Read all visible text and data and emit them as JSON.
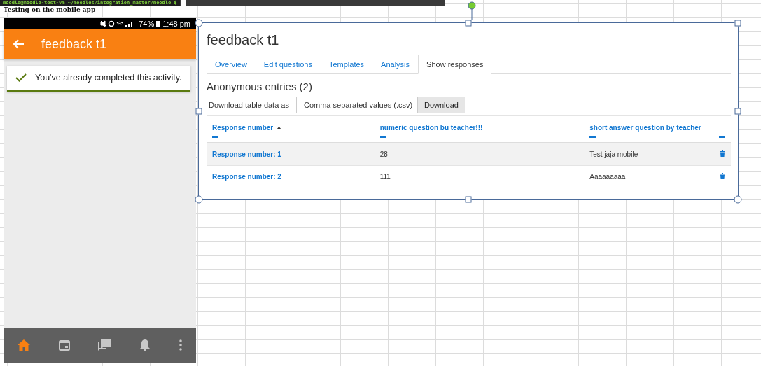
{
  "terminal": {
    "prompt": "moodle@moodle-test-vm ~/moodles/integration_master/moodle $"
  },
  "sheet_note": "Testing on the mobile app",
  "phone": {
    "status_bar": {
      "battery": "74%",
      "time": "1:48 pm"
    },
    "header": {
      "title": "feedback t1"
    },
    "notice": {
      "text": "You've already completed this activity."
    },
    "bottom_nav": [
      {
        "kind": "home",
        "selected": true
      },
      {
        "kind": "calendar",
        "selected": false
      },
      {
        "kind": "messages",
        "selected": false
      },
      {
        "kind": "notifications",
        "selected": false
      },
      {
        "kind": "more",
        "selected": false
      }
    ]
  },
  "page": {
    "title": "feedback t1",
    "tabs": [
      {
        "label": "Overview",
        "selected": false
      },
      {
        "label": "Edit questions",
        "selected": false
      },
      {
        "label": "Templates",
        "selected": false
      },
      {
        "label": "Analysis",
        "selected": false
      },
      {
        "label": "Show responses",
        "selected": true
      }
    ],
    "heading": "Anonymous entries (2)",
    "download": {
      "label": "Download table data as",
      "format": "Comma separated values (.csv)",
      "button": "Download"
    },
    "table": {
      "columns": [
        {
          "label": "Response number",
          "sorted": true
        },
        {
          "label": "numeric question bu teacher!!!",
          "sorted": false
        },
        {
          "label": "short answer question by teacher",
          "sorted": false
        }
      ],
      "rows": [
        {
          "cells": [
            "Response number: 1",
            "28",
            "Test jaja mobile"
          ],
          "shaded": true
        },
        {
          "cells": [
            "Response number: 2",
            "111",
            "Aaaaaaaaa"
          ],
          "shaded": false
        }
      ]
    }
  }
}
